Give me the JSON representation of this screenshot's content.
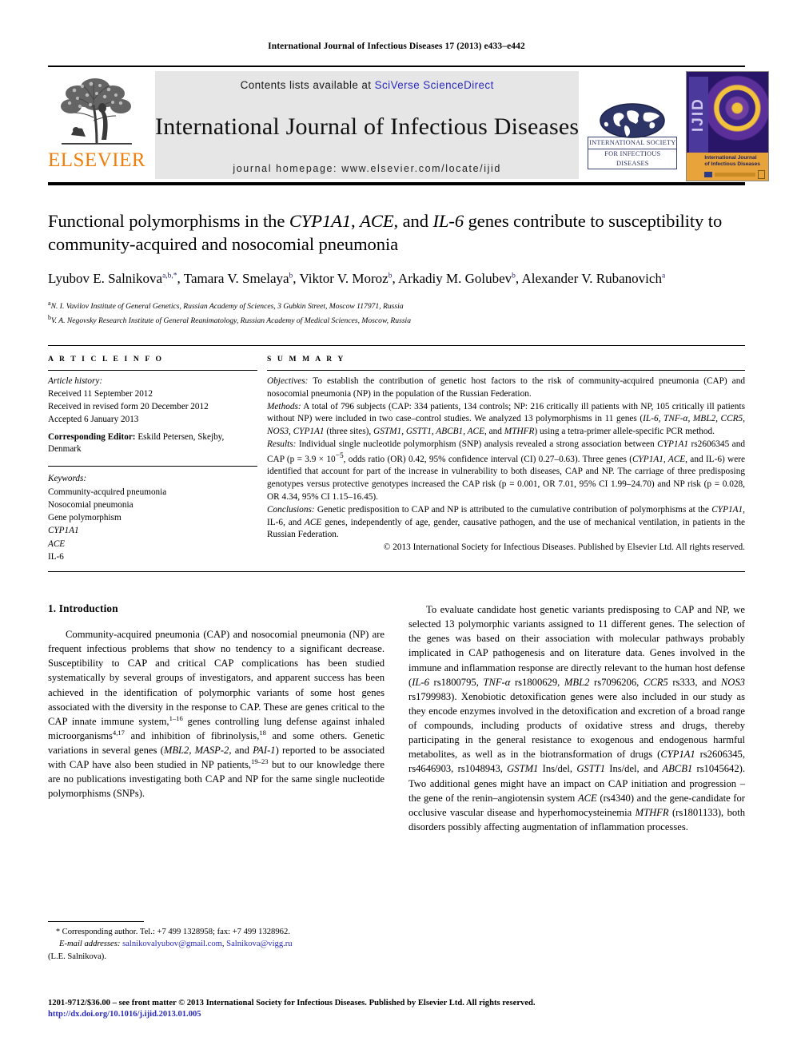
{
  "running_head": "International Journal of Infectious Diseases 17 (2013) e433–e442",
  "masthead": {
    "publisher_name": "ELSEVIER",
    "contents_prefix": "Contents lists available at ",
    "contents_link": "SciVerse ScienceDirect",
    "journal_name": "International Journal of Infectious Diseases",
    "homepage": "journal homepage: www.elsevier.com/locate/ijid",
    "society_line1": "INTERNATIONAL SOCIETY",
    "society_line2": "FOR INFECTIOUS DISEASES",
    "cover_spine": "IJID",
    "cover_title_line1": "International Journal",
    "cover_title_line2": "of Infectious Diseases"
  },
  "article": {
    "title_part1": "Functional polymorphisms in the ",
    "title_gene1": "CYP1A1",
    "title_part2": ", ",
    "title_gene2": "ACE",
    "title_part3": ", and ",
    "title_gene3": "IL-6",
    "title_part4": " genes contribute to susceptibility to community-acquired and nosocomial pneumonia",
    "authors_html": "Lyubov E. Salnikova, Tamara V. Smelaya, Viktor V. Moroz, Arkadiy M. Golubev, Alexander V. Rubanovich",
    "author_list": [
      {
        "name": "Lyubov E. Salnikova",
        "marks": "a,b,*"
      },
      {
        "name": "Tamara V. Smelaya",
        "marks": "b"
      },
      {
        "name": "Viktor V. Moroz",
        "marks": "b"
      },
      {
        "name": "Arkadiy M. Golubev",
        "marks": "b"
      },
      {
        "name": "Alexander V. Rubanovich",
        "marks": "a"
      }
    ],
    "affiliations": [
      {
        "mark": "a",
        "text": "N. I. Vavilov Institute of General Genetics, Russian Academy of Sciences, 3 Gubkin Street, Moscow 117971, Russia"
      },
      {
        "mark": "b",
        "text": "V. A. Negovsky Research Institute of General Reanimatology, Russian Academy of Medical Sciences, Moscow, Russia"
      }
    ]
  },
  "info": {
    "heading": "A R T I C L E   I N F O",
    "history_label": "Article history:",
    "history": [
      "Received 11 September 2012",
      "Received in revised form 20 December 2012",
      "Accepted 6 January 2013"
    ],
    "corresponding_label": "Corresponding Editor:",
    "corresponding_value": " Eskild Petersen, Skejby, Denmark",
    "keywords_label": "Keywords:",
    "keywords": [
      {
        "text": "Community-acquired pneumonia",
        "italic": false
      },
      {
        "text": "Nosocomial pneumonia",
        "italic": false
      },
      {
        "text": "Gene polymorphism",
        "italic": false
      },
      {
        "text": "CYP1A1",
        "italic": true
      },
      {
        "text": "ACE",
        "italic": true
      },
      {
        "text": "IL-6",
        "italic": false
      }
    ]
  },
  "summary": {
    "heading": "S U M M A R Y",
    "objectives_label": "Objectives:",
    "objectives_text": " To establish the contribution of genetic host factors to the risk of community-acquired pneumonia (CAP) and nosocomial pneumonia (NP) in the population of the Russian Federation.",
    "methods_label": "Methods:",
    "methods_text_a": " A total of 796 subjects (CAP: 334 patients, 134 controls; NP: 216 critically ill patients with NP, 105 critically ill patients without NP) were included in two case–control studies. We analyzed 13 polymorphisms in 11 genes (",
    "methods_genes": "IL-6, TNF-α, MBL2, CCR5, NOS3, CYP1A1",
    "methods_text_b": " (three sites), ",
    "methods_genes2": "GSTM1, GSTT1, ABCB1, ACE",
    "methods_text_c": ", and ",
    "methods_genes3": "MTHFR",
    "methods_text_d": ") using a tetra-primer allele-specific PCR method.",
    "results_label": "Results:",
    "results_text_a": " Individual single nucleotide polymorphism (SNP) analysis revealed a strong association between ",
    "results_gene1": "CYP1A1",
    "results_text_b": " rs2606345 and CAP (p = 3.9 × 10",
    "results_exp": "−5",
    "results_text_c": ", odds ratio (OR) 0.42, 95% confidence interval (CI) 0.27–0.63). Three genes (",
    "results_gene2": "CYP1A1, ACE",
    "results_text_d": ", and IL-6) were identified that account for part of the increase in vulnerability to both diseases, CAP and NP. The carriage of three predisposing genotypes versus protective genotypes increased the CAP risk (p = 0.001, OR 7.01, 95% CI 1.99–24.70) and NP risk (p = 0.028, OR 4.34, 95% CI 1.15–16.45).",
    "conclusions_label": "Conclusions:",
    "conclusions_text_a": " Genetic predisposition to CAP and NP is attributed to the cumulative contribution of polymorphisms at the ",
    "conclusions_gene": "CYP1A1",
    "conclusions_text_b": ", IL-6, and ",
    "conclusions_gene2": "ACE",
    "conclusions_text_c": " genes, independently of age, gender, causative pathogen, and the use of mechanical ventilation, in patients in the Russian Federation.",
    "copyright": "© 2013 International Society for Infectious Diseases. Published by Elsevier Ltd. All rights reserved."
  },
  "intro": {
    "section_number_title": "1. Introduction",
    "p1_a": "Community-acquired pneumonia (CAP) and nosocomial pneumonia (NP) are frequent infectious problems that show no tendency to a significant decrease. Susceptibility to CAP and critical CAP complications has been studied systematically by several groups of investigators, and apparent success has been achieved in the identification of polymorphic variants of some host genes associated with the diversity in the response to CAP. These are genes critical to the CAP innate immune system,",
    "p1_ref1": "1–16",
    "p1_b": " genes controlling lung defense against inhaled microorganisms",
    "p1_ref2": "4,17",
    "p1_c": " and inhibition of fibrinolysis,",
    "p1_ref3": "18",
    "p1_d": " and some others. Genetic variations in several genes (",
    "p1_genes": "MBL2, MASP-2",
    "p1_e": ", and ",
    "p1_genes2": "PAI-1",
    "p1_f": ") reported to be associated with CAP have also been studied in NP patients,",
    "p1_ref4": "19–23",
    "p1_g": " but to our knowledge there are no publications investigating both CAP and NP for the same single nucleotide polymorphisms (SNPs).",
    "p2_a": "To evaluate candidate host genetic variants predisposing to CAP and NP, we selected 13 polymorphic variants assigned to 11 different genes. The selection of the genes was based on their association with molecular pathways probably implicated in CAP pathogenesis and on literature data. Genes involved in the immune and inflammation response are directly relevant to the human host defense (",
    "p2_g1": "IL-6",
    "p2_b": " rs1800795, ",
    "p2_g2": "TNF-α",
    "p2_c": " rs1800629, ",
    "p2_g3": "MBL2",
    "p2_d": " rs7096206, ",
    "p2_g4": "CCR5",
    "p2_e": " rs333, and ",
    "p2_g5": "NOS3",
    "p2_f": " rs1799983). Xenobiotic detoxification genes were also included in our study as they encode enzymes involved in the detoxification and excretion of a broad range of compounds, including products of oxidative stress and drugs, thereby participating in the general resistance to exogenous and endogenous harmful metabolites, as well as in the biotransformation of drugs (",
    "p2_g6": "CYP1A1",
    "p2_h": " rs2606345, rs4646903, rs1048943, ",
    "p2_g7": "GSTM1",
    "p2_i": " Ins/del, ",
    "p2_g8": "GSTT1",
    "p2_j": " Ins/del, and ",
    "p2_g9": "ABCB1",
    "p2_k": " rs1045642). Two additional genes might have an impact on CAP initiation and progression – the gene of the renin–angiotensin system ",
    "p2_g10": "ACE",
    "p2_l": " (rs4340) and the gene-candidate for occlusive vascular disease and hyperhomocysteinemia ",
    "p2_g11": "MTHFR",
    "p2_m": " (rs1801133), both disorders possibly affecting augmentation of inflammation processes."
  },
  "footnote": {
    "star": "*",
    "corresponding": " Corresponding author. Tel.: +7 499 1328958; fax: +7 499 1328962.",
    "email_label": "E-mail addresses:",
    "email1": "salnikovalyubov@gmail.com",
    "email_sep": ", ",
    "email2": "Salnikova@vigg.ru",
    "email_owner": "(L.E. Salnikova)."
  },
  "page_footer": {
    "copyright_line": "1201-9712/$36.00 – see front matter © 2013 International Society for Infectious Diseases. Published by Elsevier Ltd. All rights reserved.",
    "doi": "http://dx.doi.org/10.1016/j.ijid.2013.01.005"
  },
  "colors": {
    "link": "#2b2bbb",
    "elsevier_orange": "#F07F09",
    "masthead_bg": "#e6e6e6",
    "society_navy": "#2c3566"
  }
}
